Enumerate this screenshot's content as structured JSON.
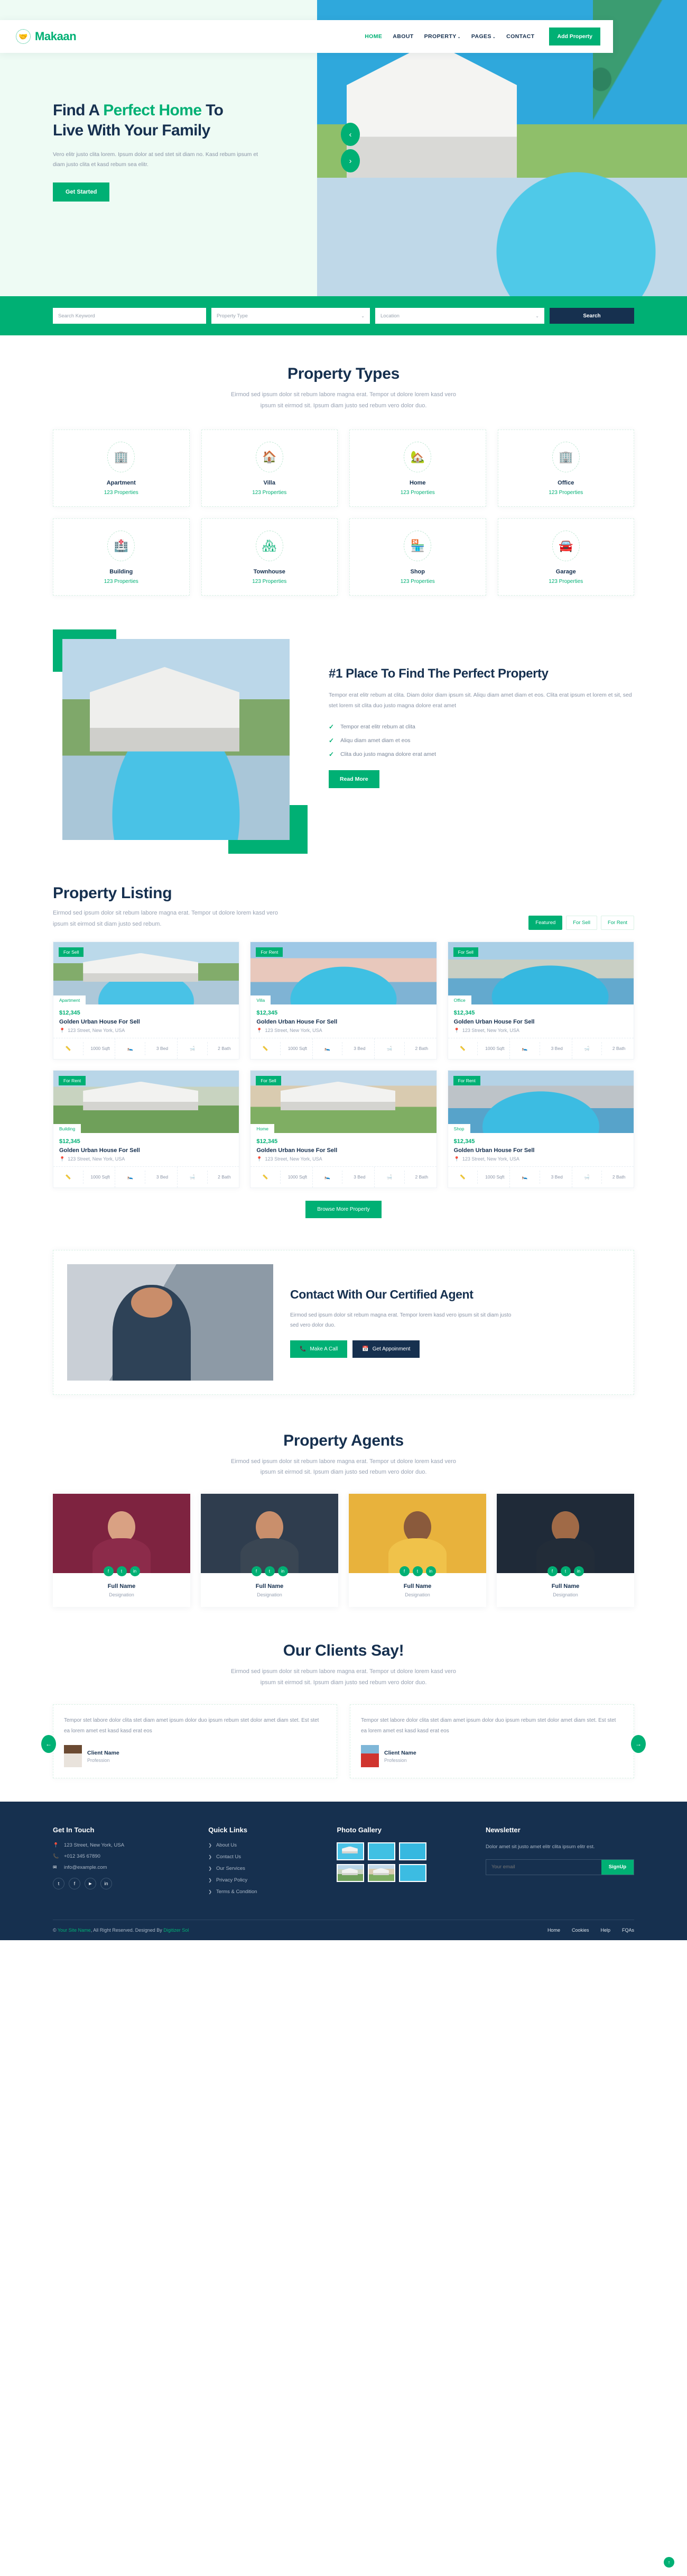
{
  "brand": {
    "name": "Makaan",
    "logo_icon": "handshake-icon"
  },
  "nav": {
    "items": [
      {
        "label": "HOME",
        "active": true
      },
      {
        "label": "ABOUT",
        "active": false
      },
      {
        "label": "PROPERTY",
        "active": false,
        "caret": "⌄"
      },
      {
        "label": "PAGES",
        "active": false,
        "caret": "⌄"
      },
      {
        "label": "CONTACT",
        "active": false
      }
    ],
    "cta": "Add Property"
  },
  "hero": {
    "title_1": "Find A ",
    "title_accent": "Perfect Home",
    "title_2": " To",
    "title_line2": "Live With Your Family",
    "paragraph": "Vero elitr justo clita lorem. Ipsum dolor at sed stet sit diam no. Kasd rebum ipsum et diam justo clita et kasd rebum sea elitr.",
    "cta": "Get Started",
    "prev_icon": "‹",
    "next_icon": "›"
  },
  "search": {
    "keyword_placeholder": "Search Keyword",
    "type_placeholder": "Property Type",
    "location_placeholder": "Location",
    "button": "Search",
    "caret": "⌄"
  },
  "property_types": {
    "title": "Property Types",
    "subtitle": "Eirmod sed ipsum dolor sit rebum labore magna erat. Tempor ut dolore lorem kasd vero ipsum sit eirmod sit. Ipsum diam justo sed rebum vero dolor duo.",
    "items": [
      {
        "name": "Apartment",
        "count": "123 Properties",
        "icon": "apartment-icon"
      },
      {
        "name": "Villa",
        "count": "123 Properties",
        "icon": "villa-icon"
      },
      {
        "name": "Home",
        "count": "123 Properties",
        "icon": "home-icon"
      },
      {
        "name": "Office",
        "count": "123 Properties",
        "icon": "office-icon"
      },
      {
        "name": "Building",
        "count": "123 Properties",
        "icon": "building-icon"
      },
      {
        "name": "Townhouse",
        "count": "123 Properties",
        "icon": "townhouse-icon"
      },
      {
        "name": "Shop",
        "count": "123 Properties",
        "icon": "shop-icon"
      },
      {
        "name": "Garage",
        "count": "123 Properties",
        "icon": "garage-icon"
      }
    ]
  },
  "about": {
    "title": "#1 Place To Find The Perfect Property",
    "paragraph": "Tempor erat elitr rebum at clita. Diam dolor diam ipsum sit. Aliqu diam amet diam et eos. Clita erat ipsum et lorem et sit, sed stet lorem sit clita duo justo magna dolore erat amet",
    "bullets": [
      "Tempor erat elitr rebum at clita",
      "Aliqu diam amet diam et eos",
      "Clita duo justo magna dolore erat amet"
    ],
    "cta": "Read More"
  },
  "listing": {
    "title": "Property Listing",
    "subtitle": "Eirmod sed ipsum dolor sit rebum labore magna erat. Tempor ut dolore lorem kasd vero ipsum sit eirmod sit diam justo sed rebum.",
    "tabs": [
      {
        "label": "Featured",
        "active": true
      },
      {
        "label": "For Sell",
        "active": false
      },
      {
        "label": "For Rent",
        "active": false
      }
    ],
    "browse_cta": "Browse More Property",
    "cards": [
      {
        "status": "For Sell",
        "type": "Apartment",
        "price": "$12,345",
        "title": "Golden Urban House For Sell",
        "address": "123 Street, New York, USA",
        "sqft": "1000 Sqft",
        "bed": "3 Bed",
        "bath": "2 Bath"
      },
      {
        "status": "For Rent",
        "type": "Villa",
        "price": "$12,345",
        "title": "Golden Urban House For Sell",
        "address": "123 Street, New York, USA",
        "sqft": "1000 Sqft",
        "bed": "3 Bed",
        "bath": "2 Bath"
      },
      {
        "status": "For Sell",
        "type": "Office",
        "price": "$12,345",
        "title": "Golden Urban House For Sell",
        "address": "123 Street, New York, USA",
        "sqft": "1000 Sqft",
        "bed": "3 Bed",
        "bath": "2 Bath"
      },
      {
        "status": "For Rent",
        "type": "Building",
        "price": "$12,345",
        "title": "Golden Urban House For Sell",
        "address": "123 Street, New York, USA",
        "sqft": "1000 Sqft",
        "bed": "3 Bed",
        "bath": "2 Bath"
      },
      {
        "status": "For Sell",
        "type": "Home",
        "price": "$12,345",
        "title": "Golden Urban House For Sell",
        "address": "123 Street, New York, USA",
        "sqft": "1000 Sqft",
        "bed": "3 Bed",
        "bath": "2 Bath"
      },
      {
        "status": "For Rent",
        "type": "Shop",
        "price": "$12,345",
        "title": "Golden Urban House For Sell",
        "address": "123 Street, New York, USA",
        "sqft": "1000 Sqft",
        "bed": "3 Bed",
        "bath": "2 Bath"
      }
    ]
  },
  "contact_agent": {
    "title": "Contact With Our Certified Agent",
    "paragraph": "Eirmod sed ipsum dolor sit rebum magna erat. Tempor lorem kasd vero ipsum sit sit diam justo sed vero dolor duo.",
    "call_cta": "Make A Call",
    "appointment_cta": "Get Appoinment"
  },
  "agents": {
    "title": "Property Agents",
    "subtitle": "Eirmod sed ipsum dolor sit rebum labore magna erat. Tempor ut dolore lorem kasd vero ipsum sit eirmod sit. Ipsum diam justo sed rebum vero dolor duo.",
    "items": [
      {
        "name": "Full Name",
        "designation": "Designation"
      },
      {
        "name": "Full Name",
        "designation": "Designation"
      },
      {
        "name": "Full Name",
        "designation": "Designation"
      },
      {
        "name": "Full Name",
        "designation": "Designation"
      }
    ]
  },
  "testimonials": {
    "title": "Our Clients Say!",
    "subtitle": "Eirmod sed ipsum dolor sit rebum labore magna erat. Tempor ut dolore lorem kasd vero ipsum sit eirmod sit. Ipsum diam justo sed rebum vero dolor duo.",
    "items": [
      {
        "text": "Tempor stet labore dolor clita stet diam amet ipsum dolor duo ipsum rebum stet dolor amet diam stet. Est stet ea lorem amet est kasd kasd erat eos",
        "name": "Client Name",
        "profession": "Profession"
      },
      {
        "text": "Tempor stet labore dolor clita stet diam amet ipsum dolor duo ipsum rebum stet dolor amet diam stet. Est stet ea lorem amet est kasd kasd erat eos",
        "name": "Client Name",
        "profession": "Profession"
      }
    ],
    "prev_icon": "←",
    "next_icon": "→"
  },
  "footer": {
    "get_in_touch": {
      "title": "Get In Touch",
      "address": "123 Street, New York, USA",
      "phone": "+012 345 67890",
      "email": "info@example.com",
      "socials": [
        "twitter-icon",
        "facebook-icon",
        "youtube-icon",
        "linkedin-icon"
      ]
    },
    "quick_links": {
      "title": "Quick Links",
      "items": [
        "About Us",
        "Contact Us",
        "Our Services",
        "Privacy Policy",
        "Terms & Condition"
      ]
    },
    "photo_gallery": {
      "title": "Photo Gallery"
    },
    "newsletter": {
      "title": "Newsletter",
      "paragraph": "Dolor amet sit justo amet elitr clita ipsum elitr est.",
      "placeholder": "Your email",
      "button": "SignUp"
    },
    "copyright_prefix": "© ",
    "copyright_brand": "Your Site Name",
    "copyright_rest": ", All Right Reserved. Designed By ",
    "copyright_designer": "Digitizer Sol",
    "bottom_links": [
      "Home",
      "Cookies",
      "Help",
      "FQAs"
    ],
    "to_top_icon": "↑"
  },
  "colors": {
    "green": "#00B074",
    "navy": "#16304F",
    "light": "#EEFBF4"
  }
}
